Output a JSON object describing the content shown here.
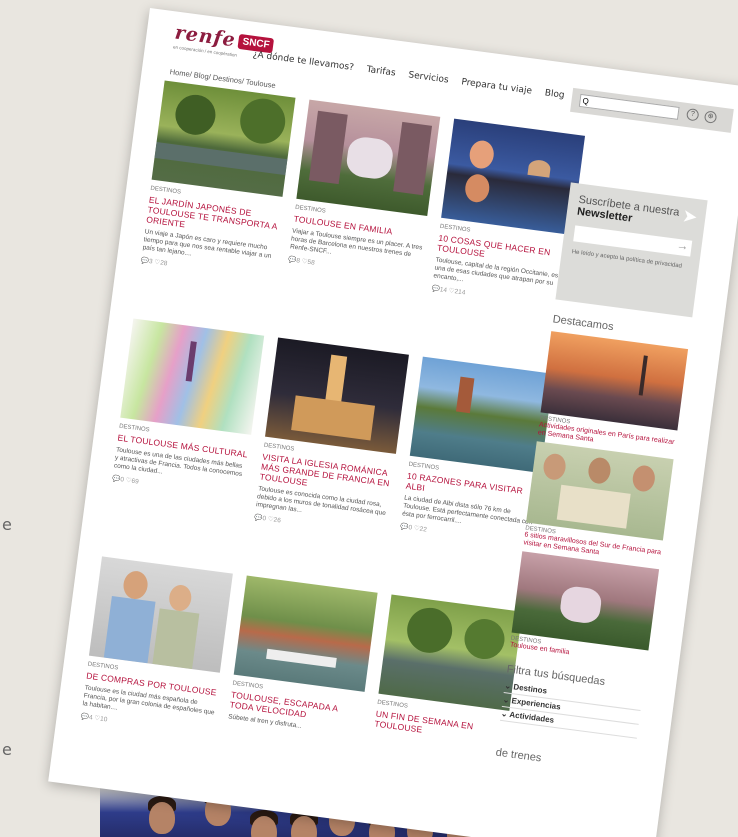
{
  "header": {
    "logo_main": "renfe",
    "logo_badge": "SNCF",
    "logo_sub": "en cooperación / en coopération"
  },
  "nav": [
    "¿A dónde te llevamos?",
    "Tarifas",
    "Servicios",
    "Prepara tu viaje",
    "Blog"
  ],
  "search": {
    "value": "Q",
    "icons": [
      "help-icon",
      "language-icon"
    ],
    "icon_glyphs": [
      "?",
      "⊕"
    ]
  },
  "breadcrumb": "Home/ Blog/ Destinos/ Toulouse",
  "cards": [
    {
      "category": "DESTINOS",
      "title": "EL JARDÍN JAPONÉS DE TOULOUSE TE TRANSPORTA A ORIENTE",
      "desc": "Un viaje a Japón es caro y requiere mucho tiempo para que nos sea rentable viajar a un país tan lejano....",
      "stats": "💬3 ♡28",
      "image": "park-canal"
    },
    {
      "category": "DESTINOS",
      "title": "TOULOUSE EN FAMILIA",
      "desc": "Viajar a Toulouse siempre es un placer. A tres horas de Barcelona en nuestros trenes de Renfe-SNCF...",
      "stats": "💬8 ♡58",
      "image": "tree-canal"
    },
    {
      "category": "DESTINOS",
      "title": "10 COSAS QUE HACER EN TOULOUSE",
      "desc": "Toulouse, capital de la región Occitanie, es una de esas ciudades que atrapan por su encanto,...",
      "stats": "💬14 ♡214",
      "image": "river-night"
    },
    {
      "category": "DESTINOS",
      "title": "EL TOULOUSE MÁS CULTURAL",
      "desc": "Toulouse es una de las ciudades más bellas y atractivas de Francia. Todos la conocemos como la ciudad...",
      "stats": "💬0 ♡69",
      "image": "watercolor-skyline"
    },
    {
      "category": "DESTINOS",
      "title": "VISITA LA IGLESIA ROMÁNICA MÁS GRANDE DE FRANCIA EN TOULOUSE",
      "desc": "Toulouse es conocida como la ciudad rosa, debido a los muros de tonalidad rosácea que impregnan las...",
      "stats": "💬0 ♡26",
      "image": "basilica-night"
    },
    {
      "category": "DESTINOS",
      "title": "10 RAZONES PARA VISITAR ALBI",
      "desc": "La ciudad de Albi dista sólo 76 km de Toulouse. Está perfectamente conectada con ésta por ferrocarril....",
      "stats": "💬0 ♡22",
      "image": "albi-river"
    },
    {
      "category": "DESTINOS",
      "title": "DE COMPRAS POR TOULOUSE",
      "desc": "Toulouse es la ciudad más española de Francia, por la gran colonia de españoles que la habitan....",
      "stats": "💬4 ♡10",
      "image": "couple"
    },
    {
      "category": "DESTINOS",
      "title": "TOULOUSE, ESCAPADA A TODA VELOCIDAD",
      "desc": "Súbete al tren y disfruta...",
      "stats": "",
      "image": "river-boat"
    },
    {
      "category": "DESTINOS",
      "title": "UN FIN DE SEMANA EN TOULOUSE",
      "desc": "",
      "stats": "",
      "image": "park-canal"
    }
  ],
  "newsletter": {
    "line1": "Suscríbete a nuestra",
    "line2": "Newsletter",
    "privacy": "He leído y acepto la política de privacidad"
  },
  "featured_heading": "Destacamos",
  "featured": [
    {
      "category": "DESTINOS",
      "title": "Actividades originales en París para realizar en Semana Santa",
      "image": "paris-sunset"
    },
    {
      "category": "DESTINOS",
      "title": "6 sitios maravillosos del Sur de Francia para visitar en Semana Santa",
      "image": "people-map"
    },
    {
      "category": "DESTINOS",
      "title": "Toulouse en familia",
      "image": "tree-canal"
    }
  ],
  "filter_heading": "Filtra tus búsquedas",
  "filters": [
    "Destinos",
    "Experiencias",
    "Actividades"
  ],
  "trains_heading": "de trenes",
  "edge_letters": [
    "e",
    "e"
  ]
}
